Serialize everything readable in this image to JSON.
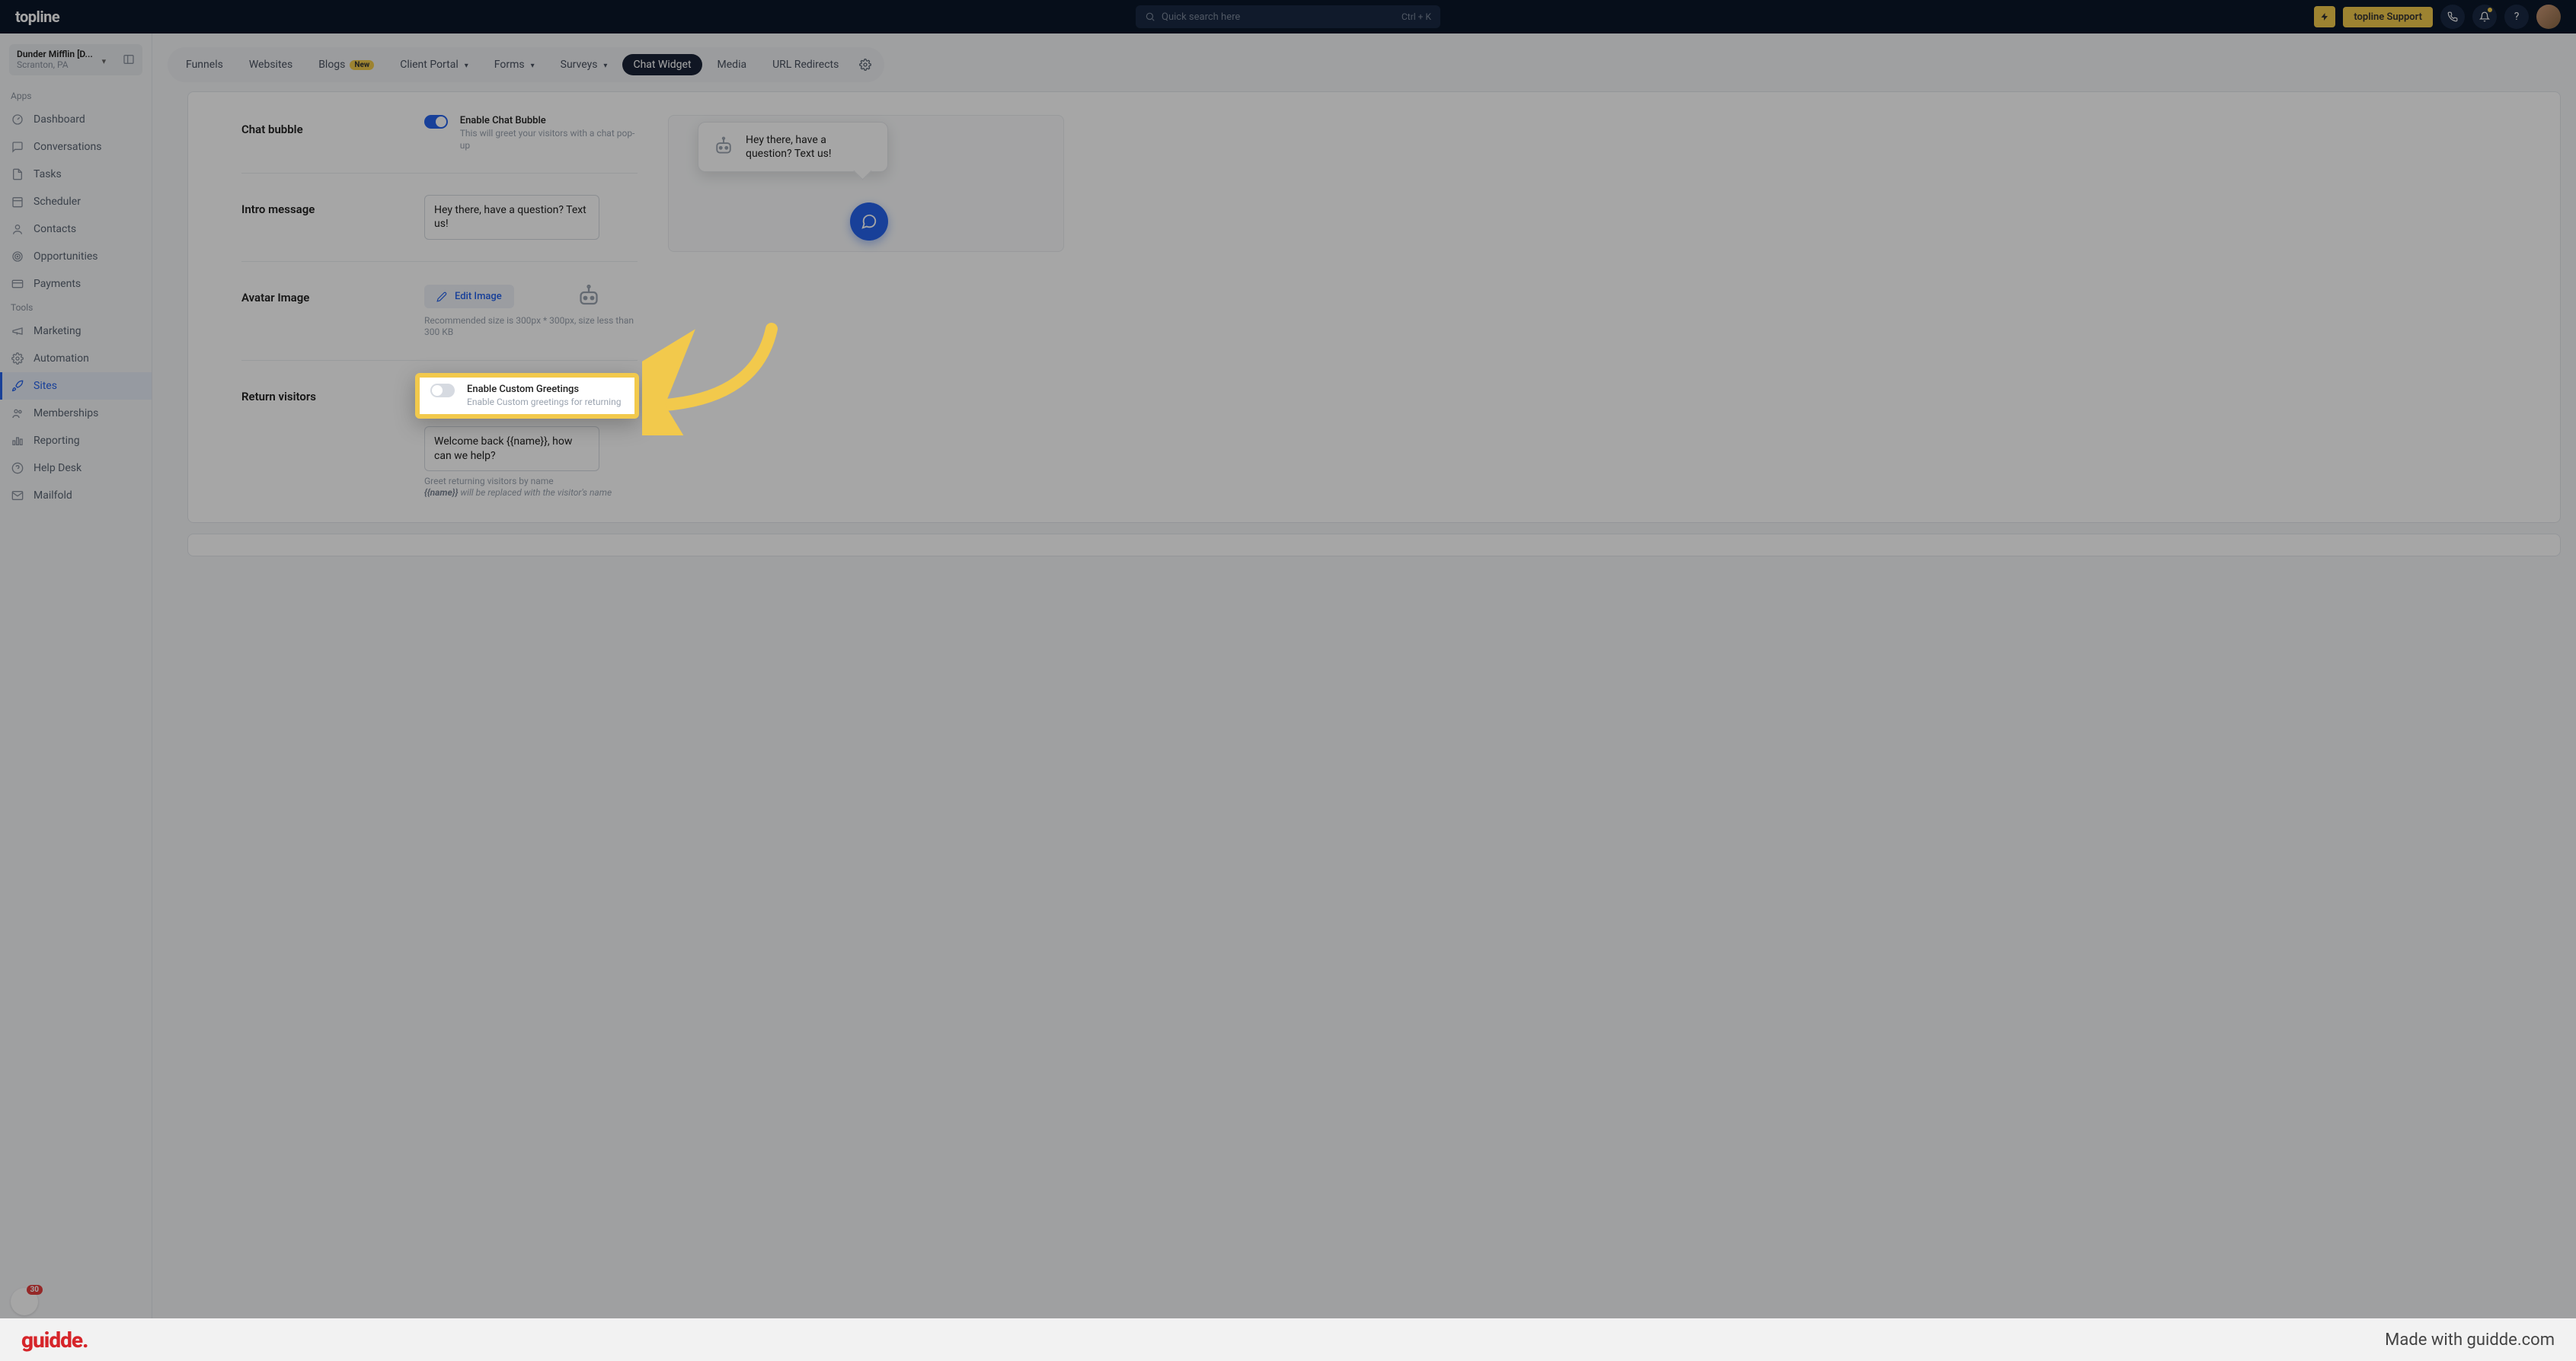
{
  "brand": "topline",
  "search": {
    "placeholder": "Quick search here",
    "shortcut": "Ctrl + K"
  },
  "topbar": {
    "support_label": "topline Support"
  },
  "workspace": {
    "name": "Dunder Mifflin [D...",
    "location": "Scranton, PA"
  },
  "sidebar": {
    "apps_label": "Apps",
    "tools_label": "Tools",
    "apps": [
      {
        "label": "Dashboard",
        "icon": "gauge"
      },
      {
        "label": "Conversations",
        "icon": "chat"
      },
      {
        "label": "Tasks",
        "icon": "doc"
      },
      {
        "label": "Scheduler",
        "icon": "cal"
      },
      {
        "label": "Contacts",
        "icon": "user"
      },
      {
        "label": "Opportunities",
        "icon": "target"
      },
      {
        "label": "Payments",
        "icon": "card"
      }
    ],
    "tools": [
      {
        "label": "Marketing",
        "icon": "mega"
      },
      {
        "label": "Automation",
        "icon": "gear"
      },
      {
        "label": "Sites",
        "icon": "rocket",
        "active": true
      },
      {
        "label": "Memberships",
        "icon": "users"
      },
      {
        "label": "Reporting",
        "icon": "bar"
      },
      {
        "label": "Help Desk",
        "icon": "help"
      },
      {
        "label": "Mailfold",
        "icon": "mail"
      }
    ],
    "rec_count": "30"
  },
  "tabs": [
    {
      "label": "Funnels"
    },
    {
      "label": "Websites"
    },
    {
      "label": "Blogs",
      "badge": "New"
    },
    {
      "label": "Client Portal",
      "caret": true
    },
    {
      "label": "Forms",
      "caret": true
    },
    {
      "label": "Surveys",
      "caret": true
    },
    {
      "label": "Chat Widget",
      "active": true
    },
    {
      "label": "Media"
    },
    {
      "label": "URL Redirects"
    }
  ],
  "content": {
    "chat_bubble": {
      "label": "Chat bubble",
      "toggle_title": "Enable Chat Bubble",
      "toggle_desc": "This will greet your visitors with a chat pop-up"
    },
    "intro": {
      "label": "Intro message",
      "value": "Hey there, have a question? Text us!"
    },
    "avatar": {
      "label": "Avatar Image",
      "button": "Edit Image",
      "hint": "Recommended size is 300px * 300px, size less than 300 KB"
    },
    "return": {
      "label": "Return visitors",
      "toggle_title": "Enable Custom Greetings",
      "toggle_desc": "Enable Custom greetings for returning",
      "greeting_value": "Welcome back {{name}}, how can we help?",
      "hint_line1": "Greet returning visitors by name",
      "hint_token": "{{name}}",
      "hint_line2": " will be replaced with the visitor's name"
    },
    "preview_msg": "Hey there, have a question? Text us!"
  },
  "footer": {
    "logo": "guidde",
    "tagline": "Made with guidde.com"
  }
}
